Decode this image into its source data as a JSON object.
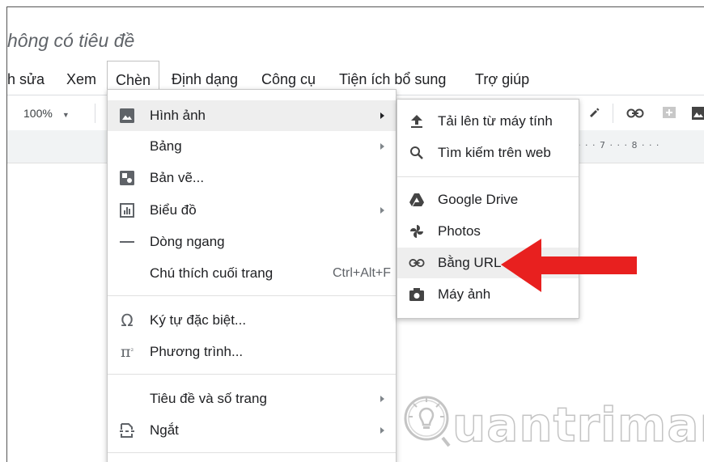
{
  "document": {
    "title": "hông có tiêu đề"
  },
  "menubar": {
    "items": [
      "h sửa",
      "Xem",
      "Chèn",
      "Định dạng",
      "Công cụ",
      "Tiện ích bổ sung",
      "Trợ giúp"
    ],
    "active": "Chèn"
  },
  "toolbar": {
    "zoom": "100%"
  },
  "ruler": {
    "text": "· · · 7 · · · 8 · · ·"
  },
  "insert_menu": {
    "items": [
      {
        "label": "Hình ảnh",
        "icon": "image-icon",
        "submenu": true,
        "highlighted": true
      },
      {
        "label": "Bảng",
        "icon": "",
        "submenu": true
      },
      {
        "label": "Bản vẽ...",
        "icon": "drawing-icon",
        "submenu": false
      },
      {
        "label": "Biểu đồ",
        "icon": "chart-icon",
        "submenu": true
      },
      {
        "label": "Dòng ngang",
        "icon": "horizontal-line-icon",
        "submenu": false
      },
      {
        "label": "Chú thích cuối trang",
        "icon": "",
        "shortcut": "Ctrl+Alt+F"
      },
      {
        "label": "Ký tự đặc biệt...",
        "icon": "omega-icon",
        "submenu": false
      },
      {
        "label": "Phương trình...",
        "icon": "pi-icon",
        "submenu": false
      },
      {
        "label": "Tiêu đề và số trang",
        "icon": "",
        "submenu": true
      },
      {
        "label": "Ngắt",
        "icon": "page-break-icon",
        "submenu": true
      }
    ]
  },
  "image_submenu": {
    "items": [
      {
        "label": "Tải lên từ máy tính",
        "icon": "upload-icon"
      },
      {
        "label": "Tìm kiếm trên web",
        "icon": "search-icon"
      },
      {
        "label": "Google Drive",
        "icon": "google-drive-icon"
      },
      {
        "label": "Photos",
        "icon": "photos-icon"
      },
      {
        "label": "Bằng URL",
        "icon": "link-icon",
        "highlighted": true
      },
      {
        "label": "Máy ảnh",
        "icon": "camera-icon"
      }
    ]
  },
  "watermark": {
    "text": "uantrimang"
  },
  "colors": {
    "accent_red": "#e8201f",
    "highlight": "#eeeeee",
    "icon_gray": "#5f6368"
  }
}
